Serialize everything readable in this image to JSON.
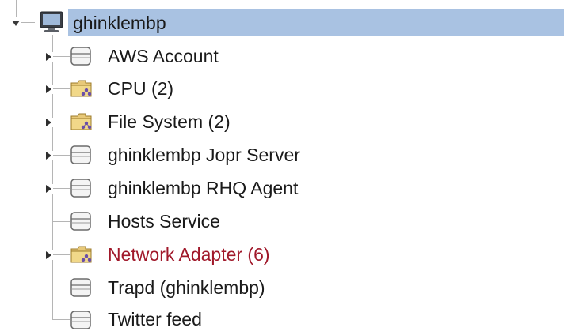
{
  "tree": {
    "root": {
      "label": "ghinklembp",
      "icon": "computer-icon",
      "expanded": true,
      "selected": true
    },
    "children": [
      {
        "label": "AWS Account",
        "icon": "service-icon",
        "expandable": true,
        "status": "normal"
      },
      {
        "label": "CPU (2)",
        "icon": "group-folder-icon",
        "expandable": true,
        "status": "normal"
      },
      {
        "label": "File System (2)",
        "icon": "group-folder-icon",
        "expandable": true,
        "status": "normal"
      },
      {
        "label": "ghinklembp Jopr Server",
        "icon": "service-icon",
        "expandable": true,
        "status": "normal"
      },
      {
        "label": "ghinklembp RHQ Agent",
        "icon": "service-icon",
        "expandable": true,
        "status": "normal"
      },
      {
        "label": "Hosts Service",
        "icon": "service-icon",
        "expandable": false,
        "status": "normal"
      },
      {
        "label": "Network Adapter (6)",
        "icon": "group-folder-icon",
        "expandable": true,
        "status": "alert"
      },
      {
        "label": "Trapd (ghinklembp)",
        "icon": "service-icon",
        "expandable": false,
        "status": "normal"
      },
      {
        "label": "Twitter feed",
        "icon": "service-icon",
        "expandable": false,
        "status": "normal"
      }
    ]
  },
  "colors": {
    "selection": "#a9c2e2",
    "alert_text": "#a0182a",
    "normal_text": "#1a1a1a"
  }
}
